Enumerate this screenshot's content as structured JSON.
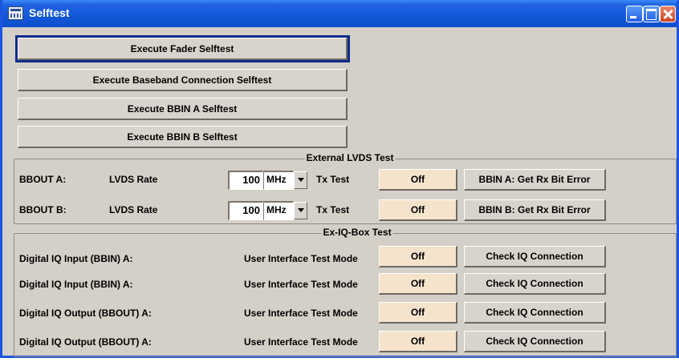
{
  "window": {
    "title": "Selftest",
    "icon": "window-app-icon"
  },
  "selftests": {
    "fader": "Execute Fader Selftest",
    "baseband": "Execute Baseband Connection Selftest",
    "bbin_a": "Execute BBIN A Selftest",
    "bbin_b": "Execute BBIN B Selftest"
  },
  "lvds": {
    "legend": "External LVDS Test",
    "rows": [
      {
        "name": "BBOUT A:",
        "rate_label": "LVDS Rate",
        "rate_value": "100",
        "unit": "MHz",
        "tx_label": "Tx Test",
        "tx_value": "Off",
        "error_button": "BBIN A:  Get Rx Bit Error"
      },
      {
        "name": "BBOUT B:",
        "rate_label": "LVDS Rate",
        "rate_value": "100",
        "unit": "MHz",
        "tx_label": "Tx Test",
        "tx_value": "Off",
        "error_button": "BBIN B:  Get Rx Bit Error"
      }
    ]
  },
  "exiq": {
    "legend": "Ex-IQ-Box Test",
    "rows": [
      {
        "name": "Digital IQ Input (BBIN) A:",
        "mode_label": "User Interface Test Mode",
        "mode_value": "Off",
        "check_button": "Check IQ Connection"
      },
      {
        "name": "Digital IQ Input (BBIN) A:",
        "mode_label": "User Interface Test Mode",
        "mode_value": "Off",
        "check_button": "Check IQ Connection"
      },
      {
        "name": "Digital IQ Output (BBOUT) A:",
        "mode_label": "User Interface Test Mode",
        "mode_value": "Off",
        "check_button": "Check IQ Connection"
      },
      {
        "name": "Digital IQ Output (BBOUT) A:",
        "mode_label": "User Interface Test Mode",
        "mode_value": "Off",
        "check_button": "Check IQ Connection"
      }
    ]
  },
  "colors": {
    "titlebar": "#1257d8",
    "panel": "#d4d0c8",
    "off_button": "#f5e3cc",
    "focus": "#0a2c8c"
  }
}
